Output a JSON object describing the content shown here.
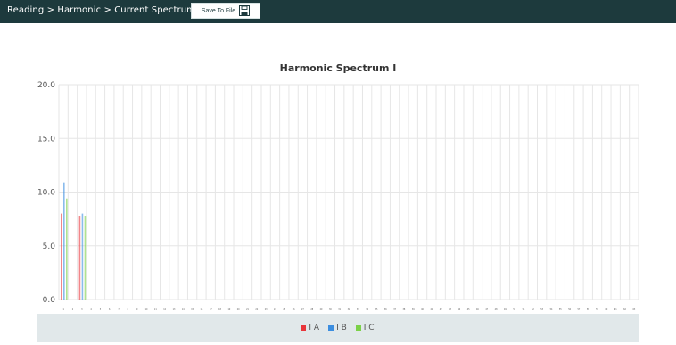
{
  "header": {
    "breadcrumb": "Reading > Harmonic > Current Spectrum",
    "save_label": "Save To File",
    "save_icon": "floppy-disk-icon"
  },
  "colors": {
    "header_bg": "#1d3a3d",
    "grid": "#e6e6e6",
    "legend_bg": "#e1e8ea",
    "series": [
      "#e8353a",
      "#3c8ee0",
      "#7bd148"
    ]
  },
  "chart_data": {
    "type": "bar",
    "title": "Harmonic Spectrum I",
    "xlabel": "",
    "ylabel": "",
    "ylim": [
      0,
      20
    ],
    "yticks": [
      "20.0",
      "15.0",
      "10.0",
      "5.0",
      "0.0"
    ],
    "categories": [
      1,
      2,
      3,
      4,
      5,
      6,
      7,
      8,
      9,
      10,
      11,
      12,
      13,
      14,
      15,
      16,
      17,
      18,
      19,
      20,
      21,
      22,
      23,
      24,
      25,
      26,
      27,
      28,
      29,
      30,
      31,
      32,
      33,
      34,
      35,
      36,
      37,
      38,
      39,
      40,
      41,
      42,
      43,
      44,
      45,
      46,
      47,
      48,
      49,
      50,
      51,
      52,
      53,
      54,
      55,
      56,
      57,
      58,
      59,
      60,
      61,
      62,
      63
    ],
    "series": [
      {
        "name": "I A",
        "values": [
          8.0,
          0,
          7.8,
          0,
          0,
          0,
          0,
          0,
          0,
          0,
          0,
          0,
          0,
          0,
          0,
          0,
          0,
          0,
          0,
          0,
          0,
          0,
          0,
          0,
          0,
          0,
          0,
          0,
          0,
          0,
          0,
          0,
          0,
          0,
          0,
          0,
          0,
          0,
          0,
          0,
          0,
          0,
          0,
          0,
          0,
          0,
          0,
          0,
          0,
          0,
          0,
          0,
          0,
          0,
          0,
          0,
          0,
          0,
          0,
          0,
          0,
          0,
          0
        ]
      },
      {
        "name": "I B",
        "values": [
          10.9,
          0,
          8.0,
          0,
          0,
          0,
          0,
          0,
          0,
          0,
          0,
          0,
          0,
          0,
          0,
          0,
          0,
          0,
          0,
          0,
          0,
          0,
          0,
          0,
          0,
          0,
          0,
          0,
          0,
          0,
          0,
          0,
          0,
          0,
          0,
          0,
          0,
          0,
          0,
          0,
          0,
          0,
          0,
          0,
          0,
          0,
          0,
          0,
          0,
          0,
          0,
          0,
          0,
          0,
          0,
          0,
          0,
          0,
          0,
          0,
          0,
          0,
          0
        ]
      },
      {
        "name": "I C",
        "values": [
          9.4,
          0,
          7.8,
          0,
          0,
          0,
          0,
          0,
          0,
          0,
          0,
          0,
          0,
          0,
          0,
          0,
          0,
          0,
          0,
          0,
          0,
          0,
          0,
          0,
          0,
          0,
          0,
          0,
          0,
          0,
          0,
          0,
          0,
          0,
          0,
          0,
          0,
          0,
          0,
          0,
          0,
          0,
          0,
          0,
          0,
          0,
          0,
          0,
          0,
          0,
          0,
          0,
          0,
          0,
          0,
          0,
          0,
          0,
          0,
          0,
          0,
          0,
          0
        ]
      }
    ],
    "grid": true,
    "legend_placement": "bottom"
  }
}
